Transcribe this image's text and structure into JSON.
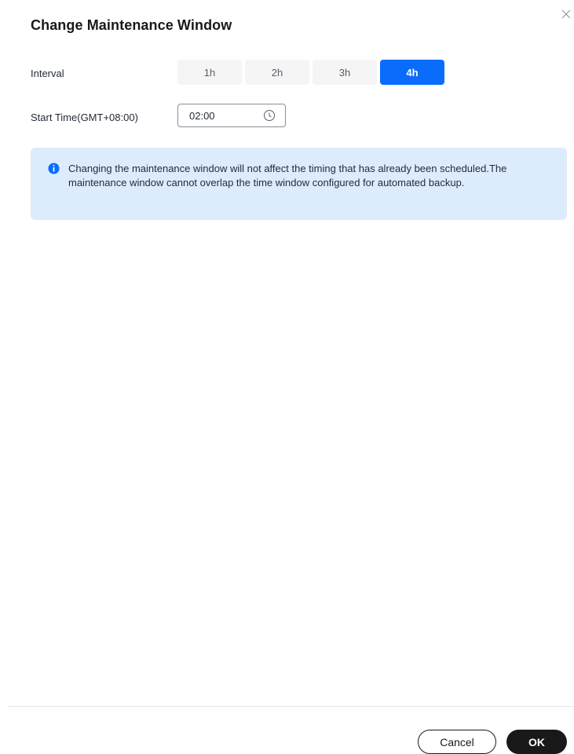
{
  "dialog": {
    "title": "Change Maintenance Window",
    "close_icon": "close-icon"
  },
  "interval": {
    "label": "Interval",
    "options": [
      "1h",
      "2h",
      "3h",
      "4h"
    ],
    "selected": "4h"
  },
  "start_time": {
    "label": "Start Time(GMT+08:00)",
    "value": "02:00",
    "icon": "clock-icon"
  },
  "notice": {
    "icon": "info-icon",
    "text": "Changing the maintenance window will not affect the timing that has already been scheduled.The maintenance window cannot overlap the time window configured for automated backup."
  },
  "footer": {
    "cancel_label": "Cancel",
    "ok_label": "OK"
  },
  "colors": {
    "accent": "#0a6cfb",
    "notice_bg": "#dcecfd",
    "primary_button": "#191919"
  }
}
